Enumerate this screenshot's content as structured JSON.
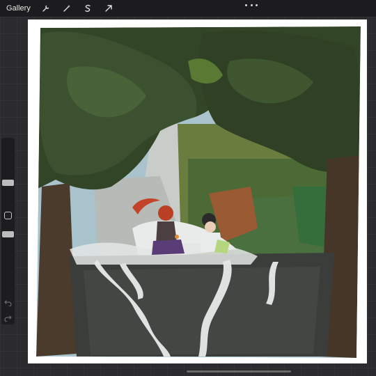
{
  "topbar": {
    "gallery_label": "Gallery",
    "tools": [
      {
        "name": "wrench-icon"
      },
      {
        "name": "magic-wand-icon"
      },
      {
        "name": "selection-s-icon"
      },
      {
        "name": "transform-arrow-icon"
      }
    ],
    "more_icon": "ellipsis-icon"
  },
  "sidebar": {
    "brush_size_icon": "brush-size-slider",
    "modify_icon": "square-modify-icon",
    "opacity_icon": "opacity-slider",
    "undo_icon": "undo-icon",
    "redo_icon": "redo-icon"
  },
  "canvas": {
    "artwork": "painting-waterfall-two-characters"
  },
  "colors": {
    "app_bg": "#2b2b2d",
    "toolbar_bg": "#1c1c1e",
    "canvas_bg": "#ffffff",
    "foliage_dark": "#2f3f27",
    "foliage_mid": "#3f5530",
    "rock": "#3c3f3c",
    "water": "#dfe2e0"
  }
}
